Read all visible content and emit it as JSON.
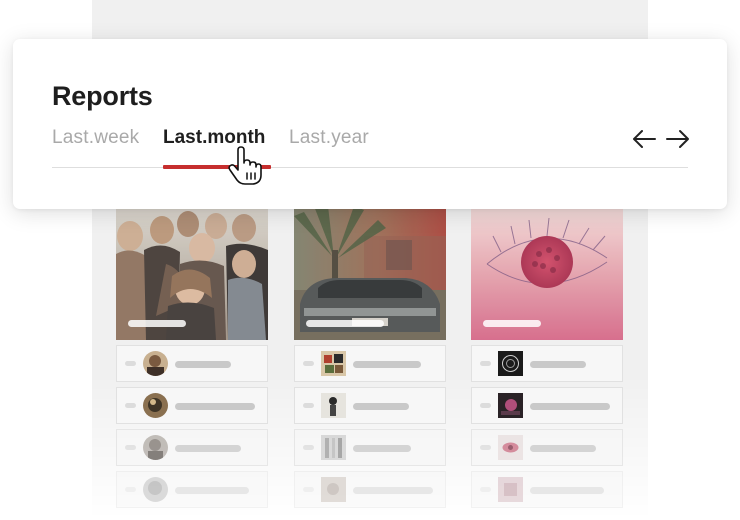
{
  "reports": {
    "title": "Reports",
    "tabs": [
      {
        "label": "Last.week",
        "active": false
      },
      {
        "label": "Last.month",
        "active": true
      },
      {
        "label": "Last.year",
        "active": false
      }
    ],
    "accent_color": "#c62e2e",
    "nav": {
      "prev_icon": "arrow-left-icon",
      "next_icon": "arrow-right-icon"
    }
  },
  "albums": [
    {
      "cover": "band-photo",
      "tracks": 4
    },
    {
      "cover": "car-under-palm-tree",
      "tracks": 4
    },
    {
      "cover": "pink-eye-drawing",
      "tracks": 4
    }
  ],
  "cursor": "hand-pointer-icon"
}
